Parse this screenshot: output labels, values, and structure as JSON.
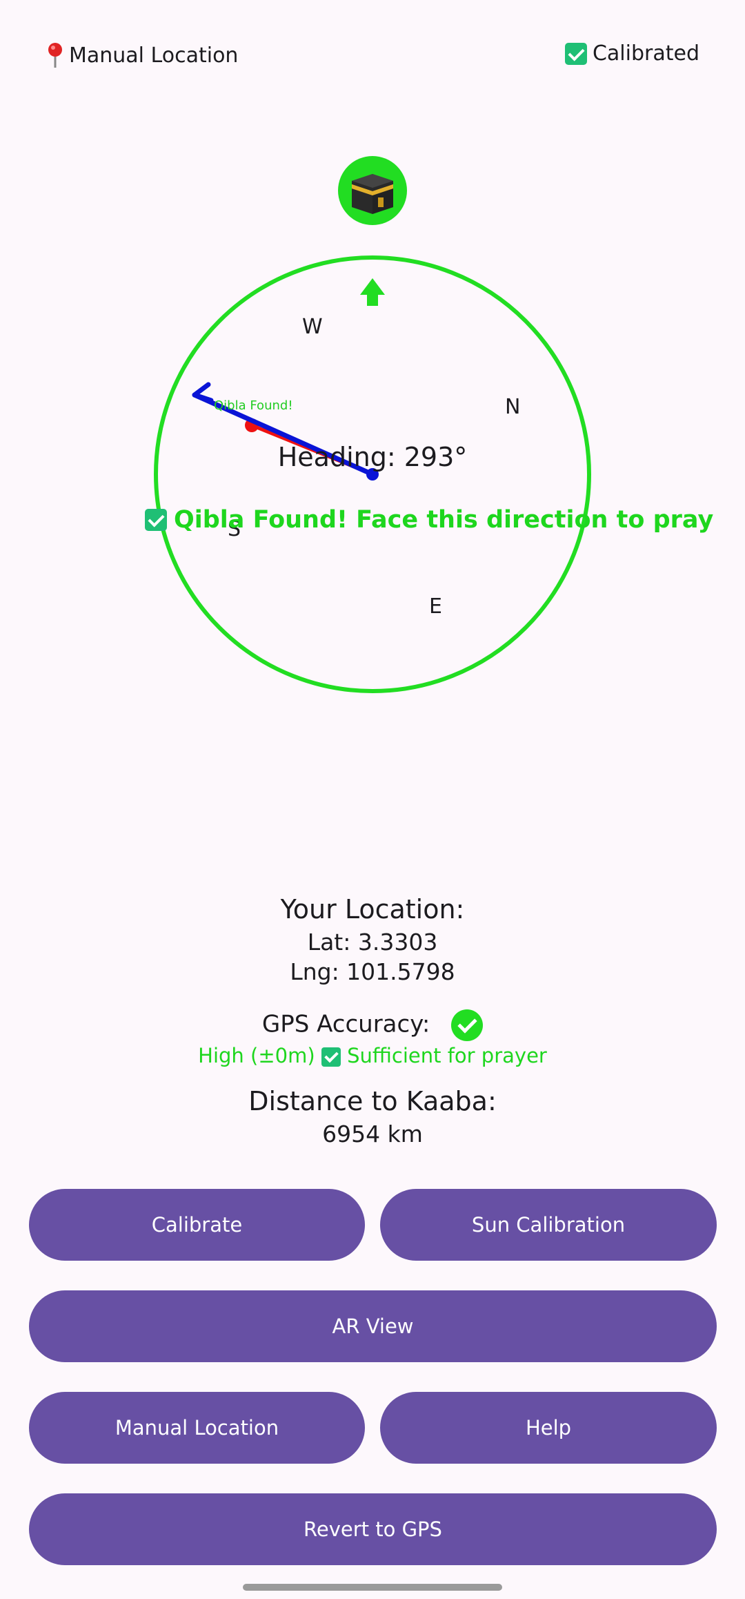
{
  "top": {
    "location_mode": "Manual Location",
    "calibration": "Calibrated"
  },
  "compass": {
    "directions": {
      "w": "W",
      "n": "N",
      "s": "S",
      "e": "E"
    },
    "arrow_label": "Qibla Found!",
    "heading": "Heading: 293°",
    "qibla_message": "Qibla Found! Face this direction to pray",
    "ring_color": "#22dd22",
    "needle_color": "#0a14d6",
    "qibla_marker_color": "#ee1111"
  },
  "location": {
    "title": "Your Location:",
    "lat": "Lat: 3.3303",
    "lng": "Lng: 101.5798"
  },
  "gps": {
    "title": "GPS Accuracy:",
    "detail": "High (±0m)",
    "sufficient": "Sufficient for prayer"
  },
  "distance": {
    "title": "Distance to Kaaba:",
    "value": "6954 km"
  },
  "buttons": {
    "calibrate": "Calibrate",
    "sun_calibration": "Sun Calibration",
    "ar_view": "AR View",
    "manual_location": "Manual Location",
    "help": "Help",
    "revert_gps": "Revert to GPS"
  },
  "colors": {
    "button": "#6750a4",
    "accent_green": "#1ed61e"
  }
}
